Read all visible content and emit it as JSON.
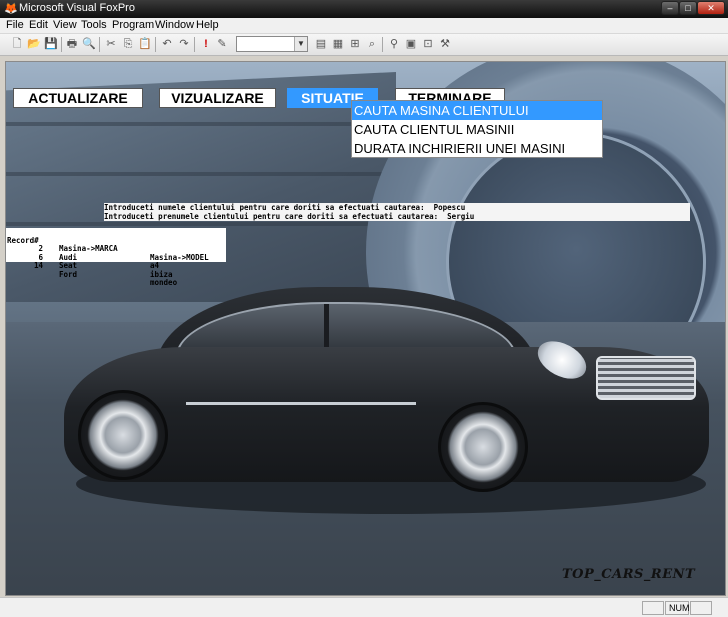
{
  "window": {
    "title": "Microsoft Visual FoxPro"
  },
  "menubar": [
    "File",
    "Edit",
    "View",
    "Tools",
    "Program",
    "Window",
    "Help"
  ],
  "form_menu": {
    "buttons": [
      "ACTUALIZARE",
      "VIZUALIZARE",
      "SITUATIE",
      "TERMINARE"
    ],
    "active": "SITUATIE",
    "dropdown": [
      "CAUTA MASINA CLIENTULUI",
      "CAUTA CLIENTUL MASINII",
      "DURATA INCHIRIERII UNEI MASINI"
    ],
    "highlighted": "CAUTA MASINA CLIENTULUI"
  },
  "console": {
    "line1": "Introduceti numele clientului pentru care doriti sa efectuati cautarea:  Popescu",
    "line2": "Introduceti prenumele clientului pentru care doriti sa efectuati cautarea:  Sergiu"
  },
  "browse": {
    "headers": [
      "Record#",
      "Masina->MARCA",
      "Masina->MODEL"
    ],
    "rows": [
      [
        "2",
        "Audi",
        "a4"
      ],
      [
        "6",
        "Seat",
        "ibiza"
      ],
      [
        "14",
        "Ford",
        "mondeo"
      ]
    ]
  },
  "brand": "TOP_CARS_RENT",
  "statusbar": {
    "num": "NUM"
  },
  "icons": [
    "foxpro-app-icon",
    "new-file-icon",
    "open-icon",
    "save-icon",
    "print-icon",
    "print-preview-icon",
    "cut-icon",
    "copy-icon",
    "paste-icon",
    "undo-icon",
    "redo-icon",
    "run-icon",
    "modify-form-icon",
    "command-window-icon",
    "data-session-icon",
    "properties-icon",
    "code-icon",
    "debug-icon",
    "toolbox-icon",
    "connection-icon",
    "form-icon"
  ],
  "colors": {
    "highlight": "#3399ff",
    "titlebar": "#1e1e1e"
  }
}
